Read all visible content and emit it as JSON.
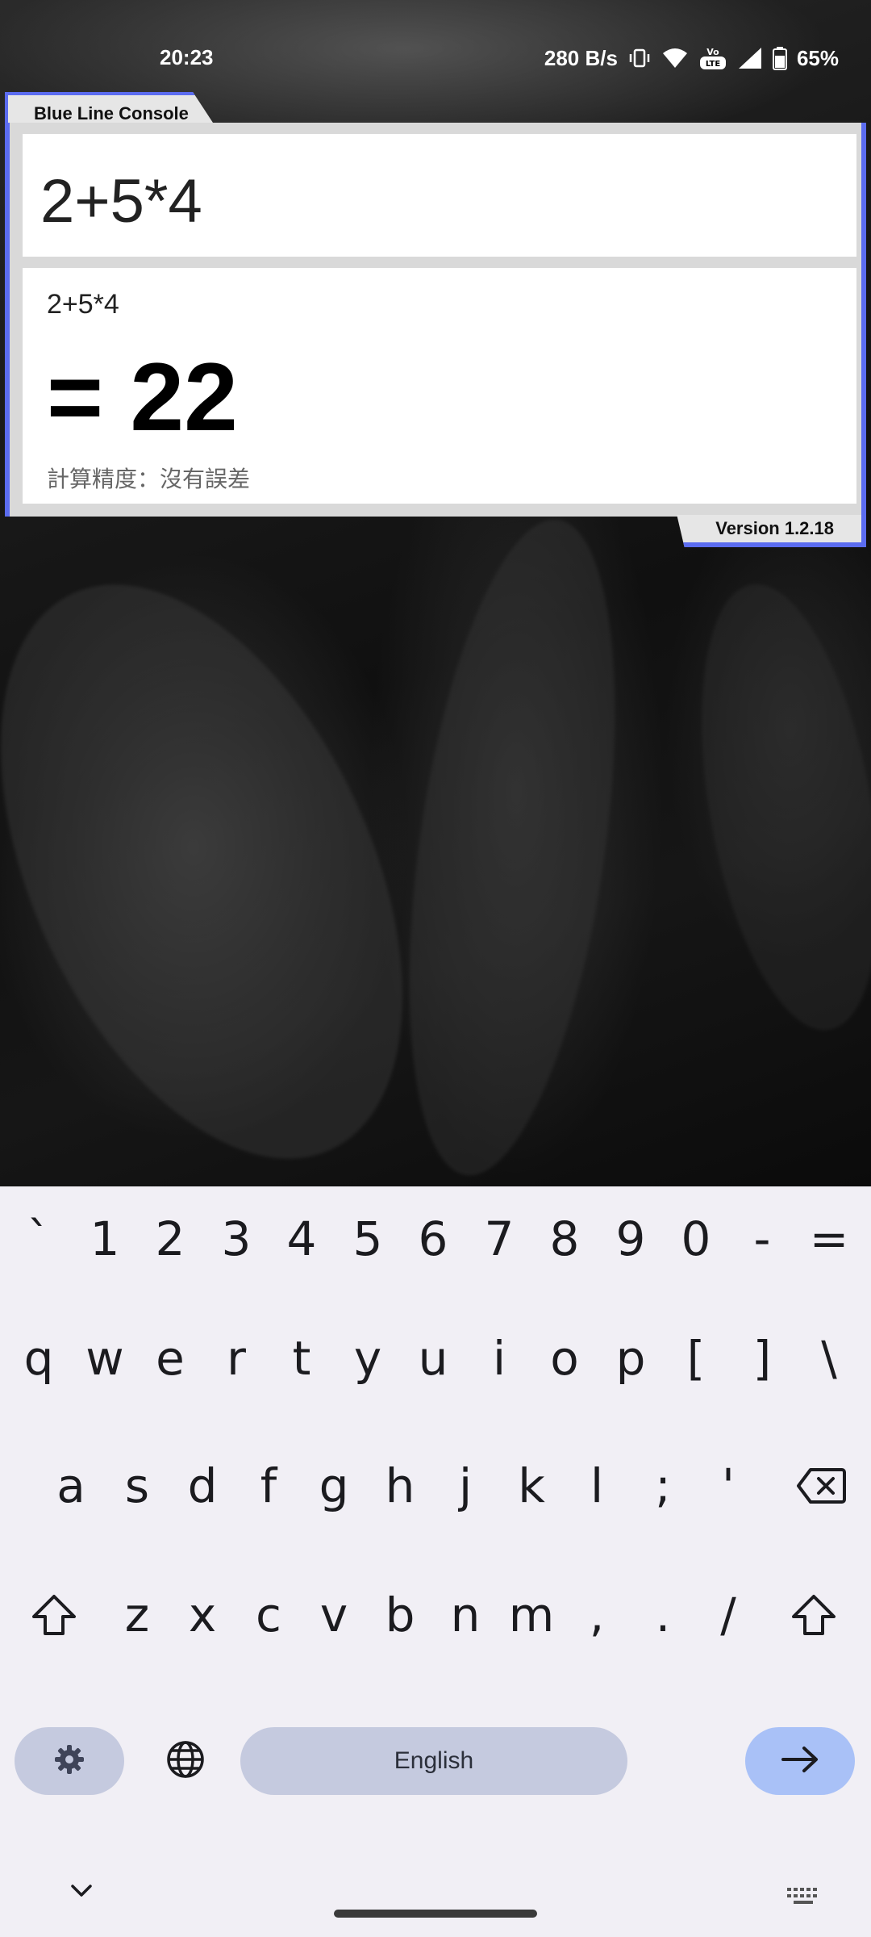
{
  "status_bar": {
    "time": "20:23",
    "net_speed": "280 B/s",
    "battery": "65%",
    "icons": [
      "vibrate-icon",
      "wifi-icon",
      "volte-icon",
      "signal-icon",
      "battery-icon"
    ]
  },
  "console": {
    "app_title": "Blue Line Console",
    "input": "2+5*4",
    "result_expression": "2+5*4",
    "result_value": "= 22",
    "precision": "計算精度：沒有誤差",
    "version": "Version 1.2.18",
    "accent_color": "#5b6cf0"
  },
  "keyboard": {
    "row1": [
      "`",
      "1",
      "2",
      "3",
      "4",
      "5",
      "6",
      "7",
      "8",
      "9",
      "0",
      "-",
      "="
    ],
    "row2": [
      "q",
      "w",
      "e",
      "r",
      "t",
      "y",
      "u",
      "i",
      "o",
      "p",
      "[",
      "]",
      "\\"
    ],
    "row3": [
      "a",
      "s",
      "d",
      "f",
      "g",
      "h",
      "j",
      "k",
      "l",
      ";",
      "'"
    ],
    "row4": [
      "z",
      "x",
      "c",
      "v",
      "b",
      "n",
      "m",
      ",",
      ".",
      "/"
    ],
    "space_label": "English",
    "icons": {
      "backspace": "backspace-icon",
      "shift": "shift-icon",
      "settings": "gear-icon",
      "language": "globe-icon",
      "enter": "arrow-right-icon",
      "hide": "chevron-down-icon",
      "switch": "keyboard-icon"
    }
  }
}
